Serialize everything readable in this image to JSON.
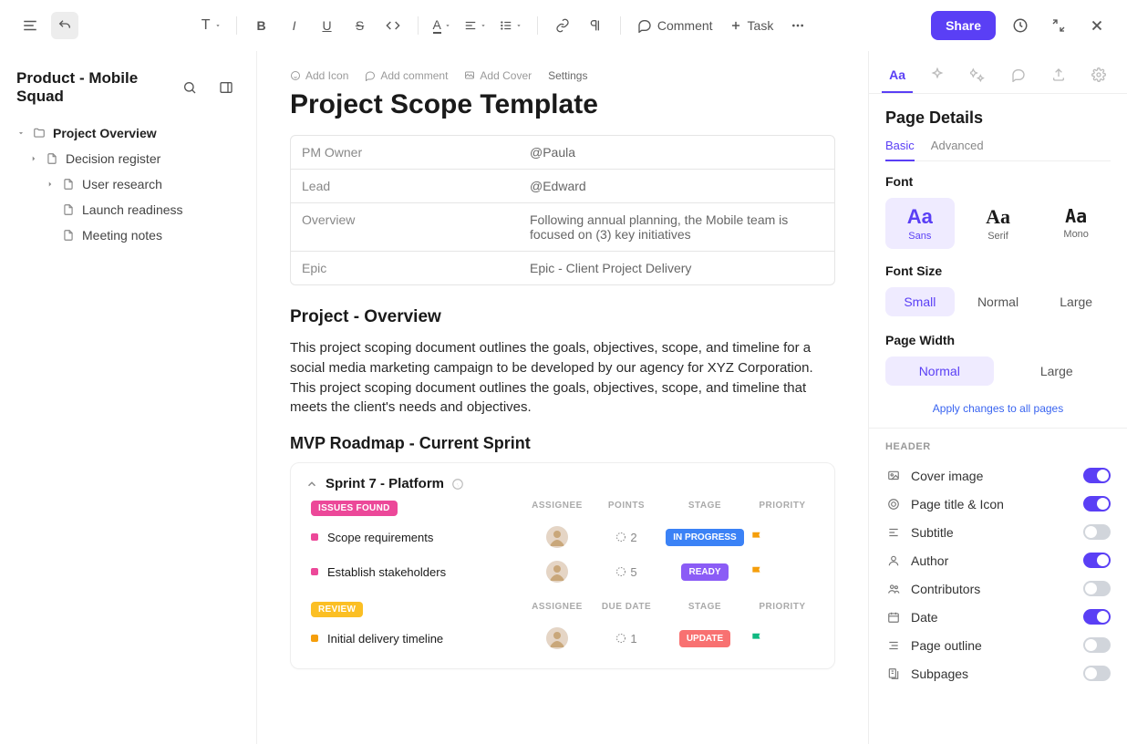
{
  "toolbar": {
    "comment": "Comment",
    "task": "Task",
    "share": "Share"
  },
  "sidebar": {
    "workspace": "Product - Mobile Squad",
    "tree": [
      {
        "label": "Project Overview",
        "level": 0,
        "bold": true,
        "expanded": true,
        "folder": true
      },
      {
        "label": "Decision register",
        "level": 1,
        "caret": true
      },
      {
        "label": "User research",
        "level": 2,
        "caret": true
      },
      {
        "label": "Launch readiness",
        "level": 2
      },
      {
        "label": "Meeting notes",
        "level": 2
      }
    ]
  },
  "page": {
    "actions": {
      "add_icon": "Add Icon",
      "add_comment": "Add comment",
      "add_cover": "Add Cover",
      "settings": "Settings"
    },
    "title": "Project Scope Template",
    "info": [
      {
        "key": "PM Owner",
        "val": "@Paula"
      },
      {
        "key": "Lead",
        "val": "@Edward"
      },
      {
        "key": "Overview",
        "val": "Following annual planning, the Mobile team is focused on (3) key initiatives"
      },
      {
        "key": "Epic",
        "val": "Epic - Client Project Delivery"
      }
    ],
    "overview_heading": "Project - Overview",
    "overview_body": "This project scoping document outlines the goals, objectives, scope, and timeline for a social media marketing campaign to be developed by our agency for XYZ Corporation. This project scoping document outlines the goals, objectives, scope, and timeline that meets the client's needs and objectives.",
    "roadmap_heading": "MVP Roadmap - Current Sprint",
    "sprint": {
      "title": "Sprint  7 - Platform",
      "groups": [
        {
          "tag": "ISSUES FOUND",
          "tag_color": "pink",
          "columns": [
            "ASSIGNEE",
            "POINTS",
            "STAGE",
            "PRIORITY"
          ],
          "rows": [
            {
              "title": "Scope requirements",
              "bullet": "pink",
              "points": "2",
              "stage": "IN PROGRESS",
              "stage_color": "blue",
              "flag": "yellow"
            },
            {
              "title": "Establish stakeholders",
              "bullet": "pink",
              "points": "5",
              "stage": "READY",
              "stage_color": "purple",
              "flag": "yellow"
            }
          ]
        },
        {
          "tag": "REVIEW",
          "tag_color": "yellow",
          "columns": [
            "ASSIGNEE",
            "DUE DATE",
            "STAGE",
            "PRIORITY"
          ],
          "rows": [
            {
              "title": "Initial delivery timeline",
              "bullet": "yellow",
              "points": "1",
              "stage": "UPDATE",
              "stage_color": "red",
              "flag": "green"
            }
          ]
        }
      ]
    }
  },
  "panel": {
    "title": "Page Details",
    "subtabs": {
      "basic": "Basic",
      "advanced": "Advanced"
    },
    "font_label": "Font",
    "fonts": [
      {
        "big": "Aa",
        "small": "Sans",
        "selected": true
      },
      {
        "big": "Aa",
        "small": "Serif",
        "cls": "serif"
      },
      {
        "big": "Aa",
        "small": "Mono",
        "cls": "mono"
      }
    ],
    "fontsize_label": "Font Size",
    "fontsizes": [
      {
        "label": "Small",
        "selected": true
      },
      {
        "label": "Normal"
      },
      {
        "label": "Large"
      }
    ],
    "pagewidth_label": "Page Width",
    "pagewidths": [
      {
        "label": "Normal",
        "selected": true
      },
      {
        "label": "Large"
      }
    ],
    "apply_link": "Apply changes to all pages",
    "header_section": "HEADER",
    "toggles": [
      {
        "icon": "image",
        "label": "Cover image",
        "on": true
      },
      {
        "icon": "title",
        "label": "Page title & Icon",
        "on": true
      },
      {
        "icon": "subtitle",
        "label": "Subtitle",
        "on": false
      },
      {
        "icon": "author",
        "label": "Author",
        "on": true
      },
      {
        "icon": "contributors",
        "label": "Contributors",
        "on": false
      },
      {
        "icon": "date",
        "label": "Date",
        "on": true
      },
      {
        "icon": "outline",
        "label": "Page outline",
        "on": false
      },
      {
        "icon": "subpages",
        "label": "Subpages",
        "on": false
      }
    ]
  }
}
